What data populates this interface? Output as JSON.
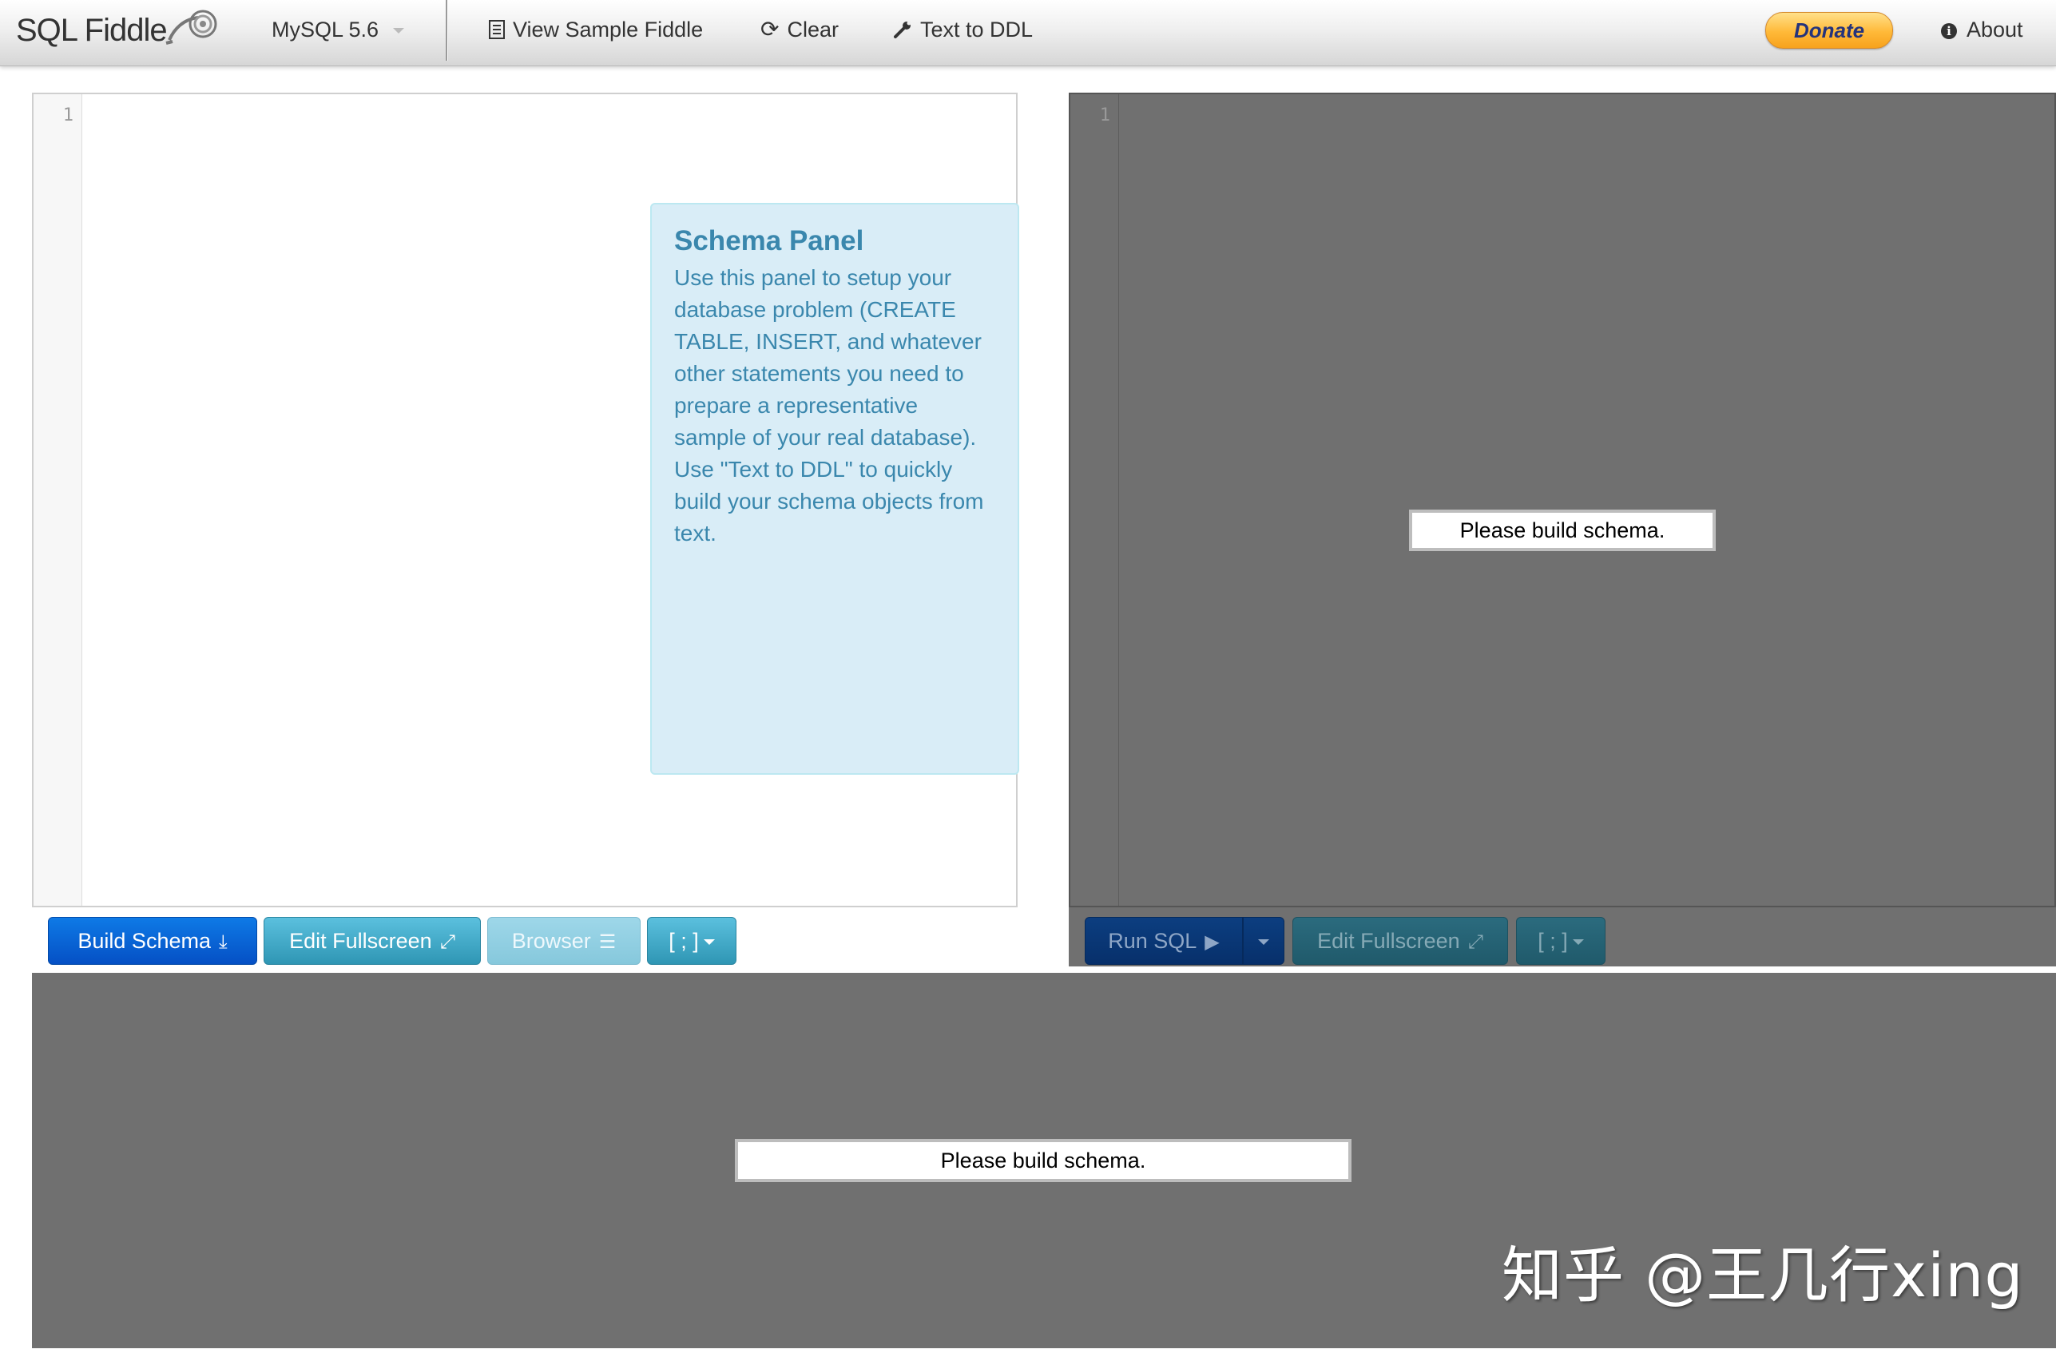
{
  "navbar": {
    "brand": "SQL Fiddle",
    "db_version": "MySQL 5.6",
    "view_sample": "View Sample Fiddle",
    "clear": "Clear",
    "text_to_ddl": "Text to DDL",
    "donate": "Donate",
    "about": "About"
  },
  "schema_panel": {
    "line_number": "1",
    "help_title": "Schema Panel",
    "help_text": "Use this panel to setup your database problem (CREATE TABLE, INSERT, and whatever other statements you need to prepare a representative sample of your real database). Use \"Text to DDL\" to quickly build your schema objects from text.",
    "buttons": {
      "build_schema": "Build Schema",
      "edit_fullscreen": "Edit Fullscreen",
      "browser": "Browser",
      "terminator": "[ ; ]"
    }
  },
  "query_panel": {
    "line_number": "1",
    "message": "Please build schema.",
    "buttons": {
      "run_sql": "Run SQL",
      "edit_fullscreen": "Edit Fullscreen",
      "terminator": "[ ; ]"
    }
  },
  "results": {
    "message": "Please build schema."
  },
  "watermark": "知乎 @王几行xing",
  "colors": {
    "primary": "#0550c5",
    "info": "#2f96b4",
    "help_bg": "#d9edf7",
    "help_text": "#3a87ad",
    "disabled_area": "#707070"
  }
}
